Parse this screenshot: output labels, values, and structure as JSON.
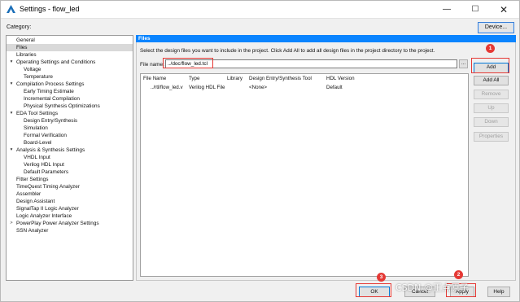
{
  "window": {
    "title": "Settings - flow_led",
    "controls": {
      "minimize": "—",
      "maximize": "☐",
      "close": "✕"
    }
  },
  "category_label": "Category:",
  "device_button": "Device...",
  "tree": [
    {
      "label": "General",
      "indent": 0,
      "caret": "",
      "selected": false
    },
    {
      "label": "Files",
      "indent": 0,
      "caret": "",
      "selected": true
    },
    {
      "label": "Libraries",
      "indent": 0,
      "caret": "",
      "selected": false
    },
    {
      "label": "Operating Settings and Conditions",
      "indent": 0,
      "caret": "▾",
      "selected": false
    },
    {
      "label": "Voltage",
      "indent": 1,
      "caret": "",
      "selected": false
    },
    {
      "label": "Temperature",
      "indent": 1,
      "caret": "",
      "selected": false
    },
    {
      "label": "Compilation Process Settings",
      "indent": 0,
      "caret": "▾",
      "selected": false
    },
    {
      "label": "Early Timing Estimate",
      "indent": 1,
      "caret": "",
      "selected": false
    },
    {
      "label": "Incremental Compilation",
      "indent": 1,
      "caret": "",
      "selected": false
    },
    {
      "label": "Physical Synthesis Optimizations",
      "indent": 1,
      "caret": "",
      "selected": false
    },
    {
      "label": "EDA Tool Settings",
      "indent": 0,
      "caret": "▾",
      "selected": false
    },
    {
      "label": "Design Entry/Synthesis",
      "indent": 1,
      "caret": "",
      "selected": false
    },
    {
      "label": "Simulation",
      "indent": 1,
      "caret": "",
      "selected": false
    },
    {
      "label": "Formal Verification",
      "indent": 1,
      "caret": "",
      "selected": false
    },
    {
      "label": "Board-Level",
      "indent": 1,
      "caret": "",
      "selected": false
    },
    {
      "label": "Analysis & Synthesis Settings",
      "indent": 0,
      "caret": "▾",
      "selected": false
    },
    {
      "label": "VHDL Input",
      "indent": 1,
      "caret": "",
      "selected": false
    },
    {
      "label": "Verilog HDL Input",
      "indent": 1,
      "caret": "",
      "selected": false
    },
    {
      "label": "Default Parameters",
      "indent": 1,
      "caret": "",
      "selected": false
    },
    {
      "label": "Fitter Settings",
      "indent": 0,
      "caret": "",
      "selected": false
    },
    {
      "label": "TimeQuest Timing Analyzer",
      "indent": 0,
      "caret": "",
      "selected": false
    },
    {
      "label": "Assembler",
      "indent": 0,
      "caret": "",
      "selected": false
    },
    {
      "label": "Design Assistant",
      "indent": 0,
      "caret": "",
      "selected": false
    },
    {
      "label": "SignalTap II Logic Analyzer",
      "indent": 0,
      "caret": "",
      "selected": false
    },
    {
      "label": "Logic Analyzer Interface",
      "indent": 0,
      "caret": "",
      "selected": false
    },
    {
      "label": "PowerPlay Power Analyzer Settings",
      "indent": 0,
      "caret": ">",
      "selected": false
    },
    {
      "label": "SSN Analyzer",
      "indent": 0,
      "caret": "",
      "selected": false
    }
  ],
  "panel": {
    "header": "Files",
    "description": "Select the design files you want to include in the project. Click Add All to add all design files in the project directory to the project.",
    "file_name_label": "File name:",
    "file_name_value": "../doc/flow_led.tcl",
    "browse_label": "..."
  },
  "table": {
    "columns": [
      "File Name",
      "Type",
      "Library",
      "Design Entry/Synthesis Tool",
      "HDL Version"
    ],
    "rows": [
      [
        "../rtl/flow_led.v",
        "Verilog HDL File",
        "",
        "<None>",
        "Default"
      ]
    ]
  },
  "side_buttons": [
    {
      "label": "Add",
      "enabled": true
    },
    {
      "label": "Add All",
      "enabled": true
    },
    {
      "label": "Remove",
      "enabled": false
    },
    {
      "label": "Up",
      "enabled": false
    },
    {
      "label": "Down",
      "enabled": false
    },
    {
      "label": "Properties",
      "enabled": false
    }
  ],
  "bottom_buttons": {
    "ok": "OK",
    "cancel": "Cancel",
    "apply": "Apply",
    "help": "Help"
  },
  "annotations": {
    "badge_1": "1",
    "badge_2": "2",
    "badge_3": "3",
    "color": "#e53935"
  },
  "watermark": "CSDN @正点原子"
}
